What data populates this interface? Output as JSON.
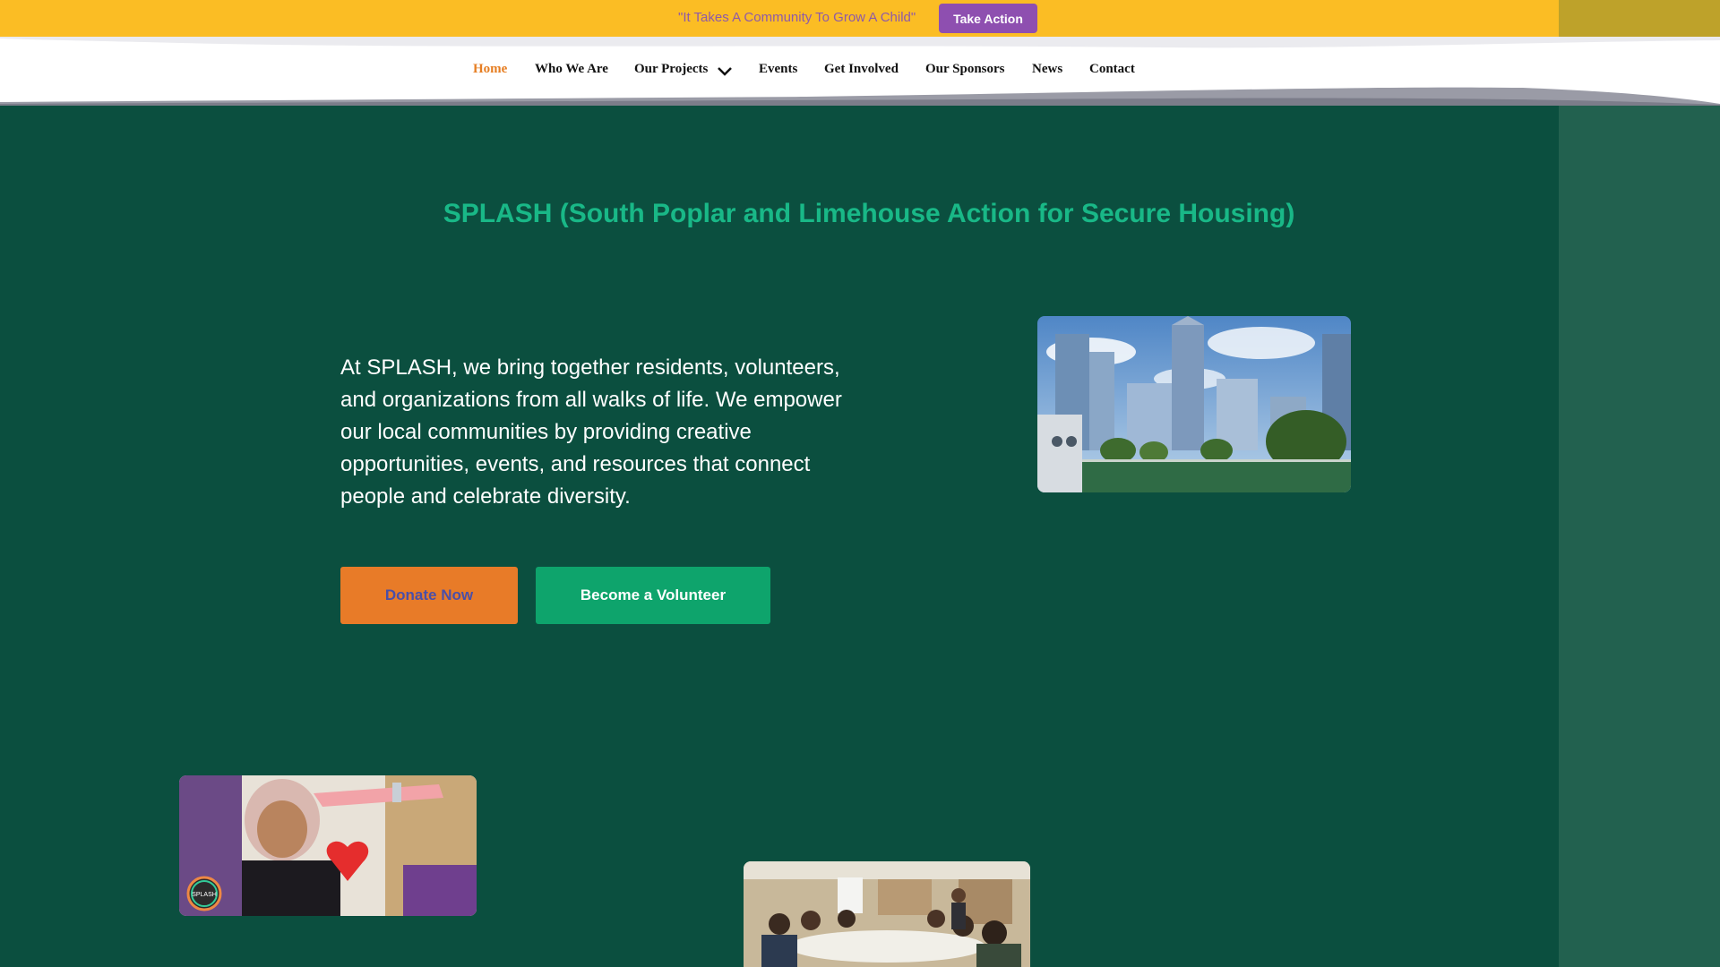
{
  "announcement": {
    "tagline": "\"It Takes A Community To Grow A Child\"",
    "cta_label": "Take Action"
  },
  "nav": {
    "items": [
      {
        "label": "Home",
        "active": true
      },
      {
        "label": "Who We Are",
        "active": false
      },
      {
        "label": "Our Projects",
        "active": false,
        "has_dropdown": true
      },
      {
        "label": "Events",
        "active": false
      },
      {
        "label": "Get Involved",
        "active": false
      },
      {
        "label": "Our Sponsors",
        "active": false
      },
      {
        "label": "News",
        "active": false
      },
      {
        "label": "Contact",
        "active": false
      }
    ],
    "dropdown_icon": "chevron-down-icon"
  },
  "hero": {
    "title": "SPLASH (South Poplar and Limehouse Action for Secure Housing)",
    "intro": "At SPLASH, we bring together residents, volunteers, and organizations from all walks of life. We empower our local communities by providing creative opportunities, events, and resources that connect people and celebrate diversity.",
    "donate_label": "Donate Now",
    "volunteer_label": "Become a Volunteer"
  },
  "photos": {
    "city_logo_text": "",
    "girl_badge_text": "SPLASH"
  },
  "colors": {
    "topbar": "#fbbd24",
    "hero_bg": "#0b4f3f",
    "accent_green": "#19b887",
    "donate": "#e87b28",
    "volunteer": "#0ea46c",
    "take_action": "#8e4fb0",
    "nav_active": "#e67e22"
  }
}
